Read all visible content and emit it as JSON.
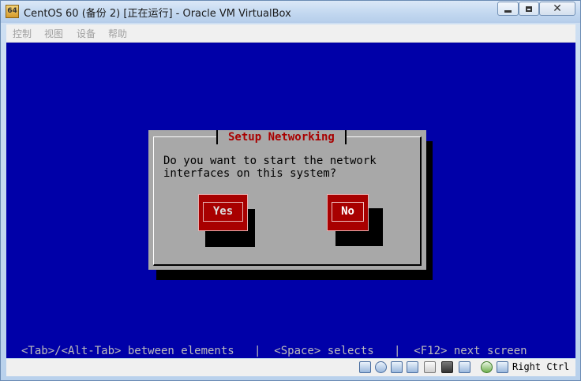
{
  "window": {
    "title": "CentOS 60 (备份 2) [正在运行] - Oracle VM VirtualBox",
    "app_icon_text": "64",
    "close_glyph": "✕"
  },
  "menubar": {
    "items": [
      {
        "label": "控制"
      },
      {
        "label": "视图"
      },
      {
        "label": "设备"
      },
      {
        "label": "帮助"
      }
    ]
  },
  "guest": {
    "dialog": {
      "title": "Setup Networking",
      "message_line1": "Do you want to start the network",
      "message_line2": "interfaces on this system?",
      "yes_label": "Yes",
      "no_label": "No"
    },
    "help_line": "<Tab>/<Alt-Tab> between elements   |  <Space> selects   |  <F12> next screen"
  },
  "statusbar": {
    "icons": [
      "hard-disk-icon",
      "optical-drive-icon",
      "usb-icon",
      "shared-folders-icon",
      "display-icon",
      "network-icon",
      "video-capture-icon",
      "guest-additions-icon",
      "mouse-integration-icon"
    ],
    "host_key_label": "Right Ctrl"
  },
  "colors": {
    "screen_bg": "#0000a8",
    "dialog_bg": "#a8a8a8",
    "button_bg": "#a80000",
    "title_text": "#a80000"
  }
}
